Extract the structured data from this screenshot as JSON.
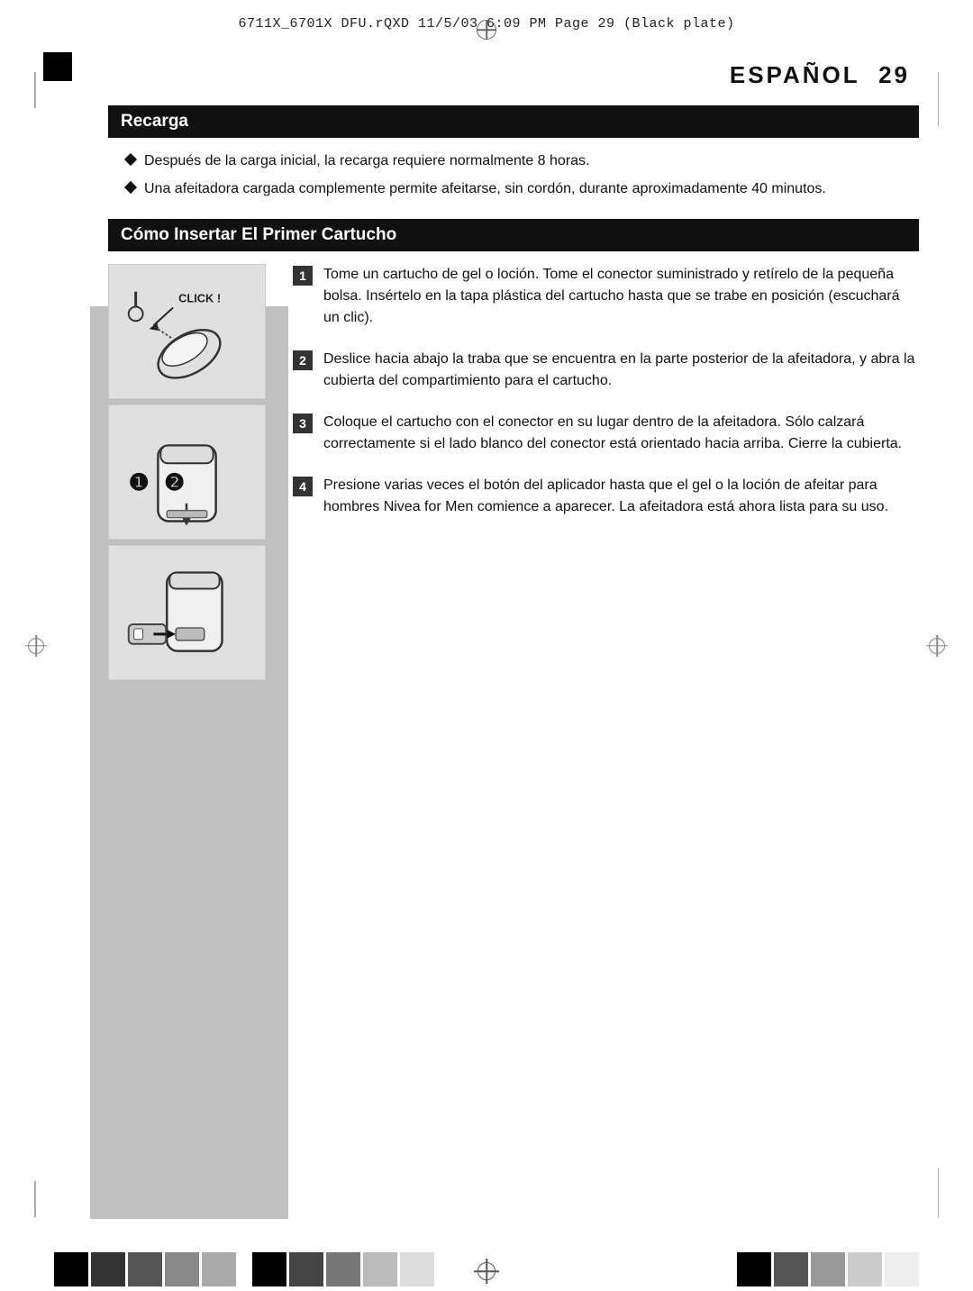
{
  "header": {
    "file_info": "6711X_6701X  DFU.rQXD    11/5/03    6:09 PM    Page  29     (Black plate)"
  },
  "page": {
    "title": "ESPAÑOL",
    "page_number": "29"
  },
  "section_recarga": {
    "heading": "Recarga",
    "bullets": [
      "Después de la carga inicial, la recarga requiere normalmente 8 horas.",
      "Una afeitadora cargada complemente permite afeitarse, sin cordón, durante aproximadamente 40 minutos."
    ]
  },
  "section_insertar": {
    "heading": "Cómo Insertar El Primer Cartucho",
    "steps": [
      {
        "number": "1",
        "text": "Tome un cartucho de gel o loción. Tome el conector suministrado y retírelo de la pequeña bolsa. Insértelo en la tapa plástica del cartucho hasta que se trabe en posición (escuchará un clic)."
      },
      {
        "number": "2",
        "text": "Deslice hacia abajo la traba que se encuentra en la parte posterior de la afeitadora, y abra la cubierta del compartimiento para el cartucho."
      },
      {
        "number": "3",
        "text": "Coloque el cartucho con el conector en su lugar dentro de la afeitadora. Sólo calzará correctamente si el lado blanco del conector está orientado hacia arriba. Cierre la cubierta."
      },
      {
        "number": "4",
        "text": "Presione varias veces el botón del aplicador hasta que el gel o la loción de afeitar para hombres Nivea for Men comience a aparecer. La afeitadora está ahora lista para su uso."
      }
    ]
  },
  "click_label": "CLICK !",
  "colors": {
    "black": "#000000",
    "dark_gray": "#333333",
    "medium_gray": "#888888",
    "light_gray": "#cccccc",
    "section_bg": "#111111",
    "sidebar_gray": "#c0c0c0"
  },
  "bottom_squares": [
    "#000000",
    "#333333",
    "#666666",
    "#999999",
    "#bbbbbb",
    "#dddddd",
    "#000000",
    "#444444",
    "#888888",
    "#cccccc",
    "#eeeeee"
  ]
}
